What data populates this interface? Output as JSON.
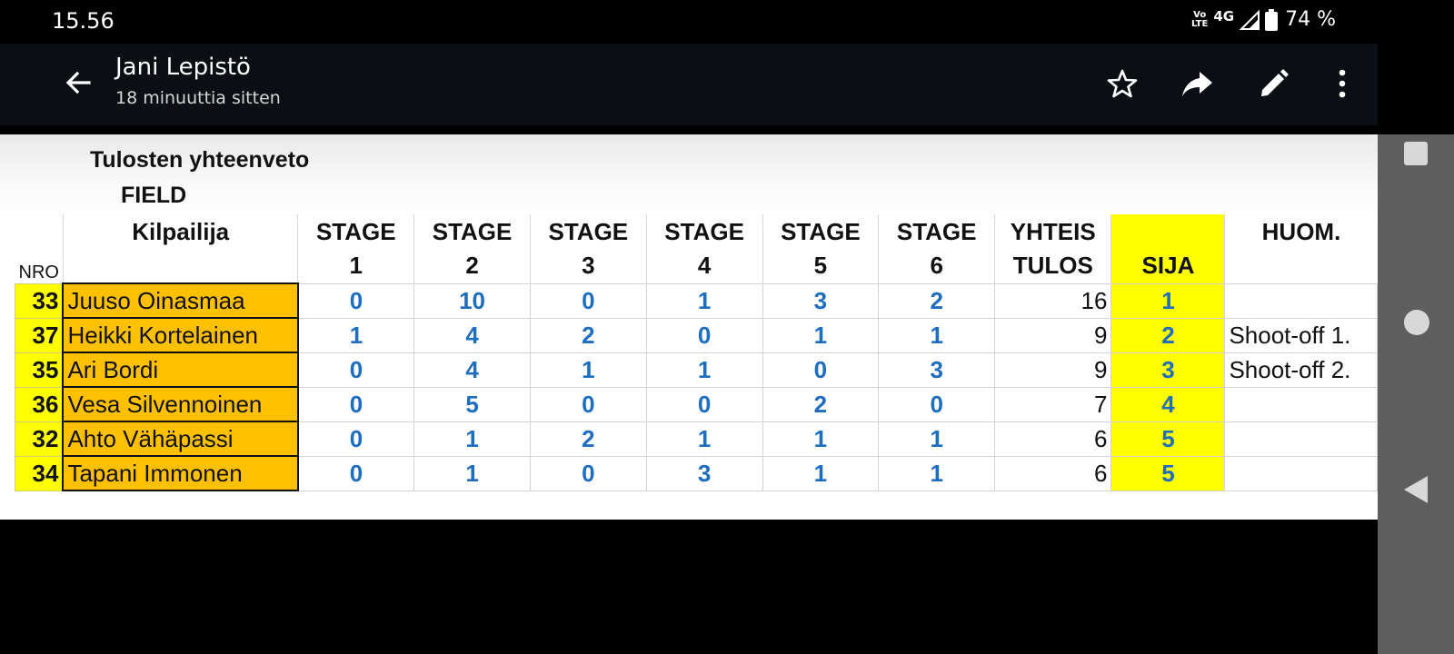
{
  "status_bar": {
    "time": "15.56",
    "volte_top": "Vo",
    "volte_bottom": "LTE",
    "network": "4G",
    "battery": "74 %"
  },
  "app_bar": {
    "sender": "Jani Lepistö",
    "subtitle": "18 minuuttia sitten",
    "icons": [
      "arrow-back-icon",
      "star-icon",
      "share-icon",
      "edit-icon",
      "more-vert-icon"
    ]
  },
  "document": {
    "title": "Tulosten yhteenveto",
    "subtitle": "FIELD",
    "headers": {
      "nro": "NRO",
      "competitor": "Kilpailija",
      "stage_top": "STAGE",
      "stages": [
        "1",
        "2",
        "3",
        "4",
        "5",
        "6"
      ],
      "total_top": "YHTEIS",
      "total_bottom": "TULOS",
      "rank": "SIJA",
      "notes": "HUOM."
    },
    "rows": [
      {
        "nro": "33",
        "name": "Juuso Oinasmaa",
        "stages": [
          "0",
          "10",
          "0",
          "1",
          "3",
          "2"
        ],
        "total": "16",
        "rank": "1",
        "note": ""
      },
      {
        "nro": "37",
        "name": "Heikki Kortelainen",
        "stages": [
          "1",
          "4",
          "2",
          "0",
          "1",
          "1"
        ],
        "total": "9",
        "rank": "2",
        "note": "Shoot-off 1."
      },
      {
        "nro": "35",
        "name": "Ari Bordi",
        "stages": [
          "0",
          "4",
          "1",
          "1",
          "0",
          "3"
        ],
        "total": "9",
        "rank": "3",
        "note": "Shoot-off 2."
      },
      {
        "nro": "36",
        "name": "Vesa Silvennoinen",
        "stages": [
          "0",
          "5",
          "0",
          "0",
          "2",
          "0"
        ],
        "total": "7",
        "rank": "4",
        "note": ""
      },
      {
        "nro": "32",
        "name": "Ahto Vähäpassi",
        "stages": [
          "0",
          "1",
          "2",
          "1",
          "1",
          "1"
        ],
        "total": "6",
        "rank": "5",
        "note": ""
      },
      {
        "nro": "34",
        "name": "Tapani Immonen",
        "stages": [
          "0",
          "1",
          "0",
          "3",
          "1",
          "1"
        ],
        "total": "6",
        "rank": "5",
        "note": ""
      }
    ]
  },
  "colors": {
    "app_bar_bg": "#0b0e12",
    "highlight_yellow": "#ffff00",
    "name_orange": "#ffc000",
    "score_blue": "#1f6dbf",
    "side_nav": "#5e5e5e"
  }
}
